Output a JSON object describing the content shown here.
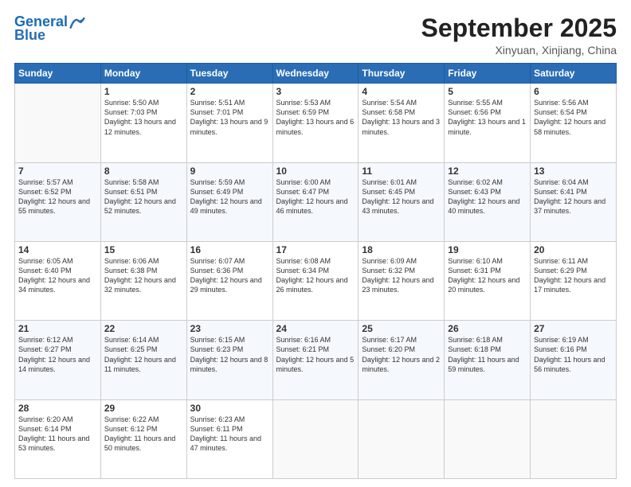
{
  "logo": {
    "line1": "General",
    "line2": "Blue"
  },
  "title": "September 2025",
  "location": "Xinyuan, Xinjiang, China",
  "headers": [
    "Sunday",
    "Monday",
    "Tuesday",
    "Wednesday",
    "Thursday",
    "Friday",
    "Saturday"
  ],
  "weeks": [
    [
      {
        "day": "",
        "sunrise": "",
        "sunset": "",
        "daylight": ""
      },
      {
        "day": "1",
        "sunrise": "Sunrise: 5:50 AM",
        "sunset": "Sunset: 7:03 PM",
        "daylight": "Daylight: 13 hours and 12 minutes."
      },
      {
        "day": "2",
        "sunrise": "Sunrise: 5:51 AM",
        "sunset": "Sunset: 7:01 PM",
        "daylight": "Daylight: 13 hours and 9 minutes."
      },
      {
        "day": "3",
        "sunrise": "Sunrise: 5:53 AM",
        "sunset": "Sunset: 6:59 PM",
        "daylight": "Daylight: 13 hours and 6 minutes."
      },
      {
        "day": "4",
        "sunrise": "Sunrise: 5:54 AM",
        "sunset": "Sunset: 6:58 PM",
        "daylight": "Daylight: 13 hours and 3 minutes."
      },
      {
        "day": "5",
        "sunrise": "Sunrise: 5:55 AM",
        "sunset": "Sunset: 6:56 PM",
        "daylight": "Daylight: 13 hours and 1 minute."
      },
      {
        "day": "6",
        "sunrise": "Sunrise: 5:56 AM",
        "sunset": "Sunset: 6:54 PM",
        "daylight": "Daylight: 12 hours and 58 minutes."
      }
    ],
    [
      {
        "day": "7",
        "sunrise": "Sunrise: 5:57 AM",
        "sunset": "Sunset: 6:52 PM",
        "daylight": "Daylight: 12 hours and 55 minutes."
      },
      {
        "day": "8",
        "sunrise": "Sunrise: 5:58 AM",
        "sunset": "Sunset: 6:51 PM",
        "daylight": "Daylight: 12 hours and 52 minutes."
      },
      {
        "day": "9",
        "sunrise": "Sunrise: 5:59 AM",
        "sunset": "Sunset: 6:49 PM",
        "daylight": "Daylight: 12 hours and 49 minutes."
      },
      {
        "day": "10",
        "sunrise": "Sunrise: 6:00 AM",
        "sunset": "Sunset: 6:47 PM",
        "daylight": "Daylight: 12 hours and 46 minutes."
      },
      {
        "day": "11",
        "sunrise": "Sunrise: 6:01 AM",
        "sunset": "Sunset: 6:45 PM",
        "daylight": "Daylight: 12 hours and 43 minutes."
      },
      {
        "day": "12",
        "sunrise": "Sunrise: 6:02 AM",
        "sunset": "Sunset: 6:43 PM",
        "daylight": "Daylight: 12 hours and 40 minutes."
      },
      {
        "day": "13",
        "sunrise": "Sunrise: 6:04 AM",
        "sunset": "Sunset: 6:41 PM",
        "daylight": "Daylight: 12 hours and 37 minutes."
      }
    ],
    [
      {
        "day": "14",
        "sunrise": "Sunrise: 6:05 AM",
        "sunset": "Sunset: 6:40 PM",
        "daylight": "Daylight: 12 hours and 34 minutes."
      },
      {
        "day": "15",
        "sunrise": "Sunrise: 6:06 AM",
        "sunset": "Sunset: 6:38 PM",
        "daylight": "Daylight: 12 hours and 32 minutes."
      },
      {
        "day": "16",
        "sunrise": "Sunrise: 6:07 AM",
        "sunset": "Sunset: 6:36 PM",
        "daylight": "Daylight: 12 hours and 29 minutes."
      },
      {
        "day": "17",
        "sunrise": "Sunrise: 6:08 AM",
        "sunset": "Sunset: 6:34 PM",
        "daylight": "Daylight: 12 hours and 26 minutes."
      },
      {
        "day": "18",
        "sunrise": "Sunrise: 6:09 AM",
        "sunset": "Sunset: 6:32 PM",
        "daylight": "Daylight: 12 hours and 23 minutes."
      },
      {
        "day": "19",
        "sunrise": "Sunrise: 6:10 AM",
        "sunset": "Sunset: 6:31 PM",
        "daylight": "Daylight: 12 hours and 20 minutes."
      },
      {
        "day": "20",
        "sunrise": "Sunrise: 6:11 AM",
        "sunset": "Sunset: 6:29 PM",
        "daylight": "Daylight: 12 hours and 17 minutes."
      }
    ],
    [
      {
        "day": "21",
        "sunrise": "Sunrise: 6:12 AM",
        "sunset": "Sunset: 6:27 PM",
        "daylight": "Daylight: 12 hours and 14 minutes."
      },
      {
        "day": "22",
        "sunrise": "Sunrise: 6:14 AM",
        "sunset": "Sunset: 6:25 PM",
        "daylight": "Daylight: 12 hours and 11 minutes."
      },
      {
        "day": "23",
        "sunrise": "Sunrise: 6:15 AM",
        "sunset": "Sunset: 6:23 PM",
        "daylight": "Daylight: 12 hours and 8 minutes."
      },
      {
        "day": "24",
        "sunrise": "Sunrise: 6:16 AM",
        "sunset": "Sunset: 6:21 PM",
        "daylight": "Daylight: 12 hours and 5 minutes."
      },
      {
        "day": "25",
        "sunrise": "Sunrise: 6:17 AM",
        "sunset": "Sunset: 6:20 PM",
        "daylight": "Daylight: 12 hours and 2 minutes."
      },
      {
        "day": "26",
        "sunrise": "Sunrise: 6:18 AM",
        "sunset": "Sunset: 6:18 PM",
        "daylight": "Daylight: 11 hours and 59 minutes."
      },
      {
        "day": "27",
        "sunrise": "Sunrise: 6:19 AM",
        "sunset": "Sunset: 6:16 PM",
        "daylight": "Daylight: 11 hours and 56 minutes."
      }
    ],
    [
      {
        "day": "28",
        "sunrise": "Sunrise: 6:20 AM",
        "sunset": "Sunset: 6:14 PM",
        "daylight": "Daylight: 11 hours and 53 minutes."
      },
      {
        "day": "29",
        "sunrise": "Sunrise: 6:22 AM",
        "sunset": "Sunset: 6:12 PM",
        "daylight": "Daylight: 11 hours and 50 minutes."
      },
      {
        "day": "30",
        "sunrise": "Sunrise: 6:23 AM",
        "sunset": "Sunset: 6:11 PM",
        "daylight": "Daylight: 11 hours and 47 minutes."
      },
      {
        "day": "",
        "sunrise": "",
        "sunset": "",
        "daylight": ""
      },
      {
        "day": "",
        "sunrise": "",
        "sunset": "",
        "daylight": ""
      },
      {
        "day": "",
        "sunrise": "",
        "sunset": "",
        "daylight": ""
      },
      {
        "day": "",
        "sunrise": "",
        "sunset": "",
        "daylight": ""
      }
    ]
  ]
}
